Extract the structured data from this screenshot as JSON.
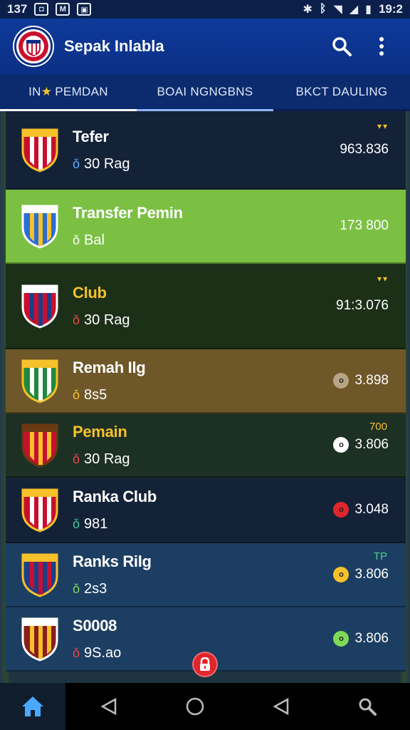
{
  "status_bar": {
    "time_left": "137",
    "time_right": "19:2"
  },
  "app_bar": {
    "title": "Sepak Inlabla"
  },
  "tabs": [
    {
      "label_prefix": "IN",
      "label": "PEMDAN",
      "active": true
    },
    {
      "label": "BOAI NGNGBNS"
    },
    {
      "label": "BKCT DAULING"
    }
  ],
  "rows": [
    {
      "title": "Tefer",
      "sub": "30 Rag",
      "value": "963.836",
      "bg": "#142238",
      "title_color": "#ffffff",
      "has_chevron": true,
      "sub_icon_color": "#5aa9ff"
    },
    {
      "title": "Transfer Pemin",
      "sub": "Bal",
      "value": "173 800",
      "bg": "#7bc043",
      "title_color": "#ffffff",
      "sub_icon_color": "#ffffff"
    },
    {
      "title": "Club",
      "sub": "30 Rag",
      "value": "91:3.076",
      "bg": "#1c3018",
      "title_color": "#f6c12a",
      "has_chevron": true,
      "sub_icon_color": "#e84a4a"
    },
    {
      "title": "Remah Ilg",
      "sub": "8s5",
      "value": "3.898",
      "bg": "#6e5728",
      "title_color": "#ffffff",
      "badge": "o",
      "badge_color": "#b8a585",
      "sub_icon_color": "#f6c12a"
    },
    {
      "title": "Pemain",
      "sub": "30 Rag",
      "value": "3.806",
      "bg": "#1c3024",
      "title_color": "#f6c12a",
      "badge": "o",
      "badge_color": "#ffffff",
      "tag": "700",
      "tag_color": "#f6c12a",
      "sub_icon_color": "#e84a4a"
    },
    {
      "title": "Ranka Club",
      "sub": "981",
      "value": "3.048",
      "bg": "#142238",
      "title_color": "#ffffff",
      "badge": "o",
      "badge_color": "#e0262c",
      "sub_icon_color": "#3fc6a0"
    },
    {
      "title": "Ranks Rilg",
      "sub": "2s3",
      "value": "3.806",
      "bg": "#1c3e62",
      "title_color": "#ffffff",
      "badge": "o",
      "badge_color": "#f6c12a",
      "tag": "TP",
      "tag_color": "#4ad08a",
      "sub_icon_color": "#7ed957"
    },
    {
      "title": "S0008",
      "sub": "9S.ao",
      "value": "3.806",
      "bg": "#1c3e62",
      "title_color": "#ffffff",
      "badge": "o",
      "badge_color": "#7ed957",
      "sub_icon_color": "#e84a4a"
    }
  ],
  "colors": {
    "app_bar": "#0e3a9a",
    "tabs_bg": "#0c2b6e",
    "accent_yellow": "#f6c12a",
    "fab_red": "#e0262c"
  },
  "icons": {
    "search": "search-icon",
    "more": "more-vert-icon",
    "home": "home-icon",
    "back": "back-icon",
    "circle": "home-circle-icon",
    "lock": "lock-icon"
  }
}
